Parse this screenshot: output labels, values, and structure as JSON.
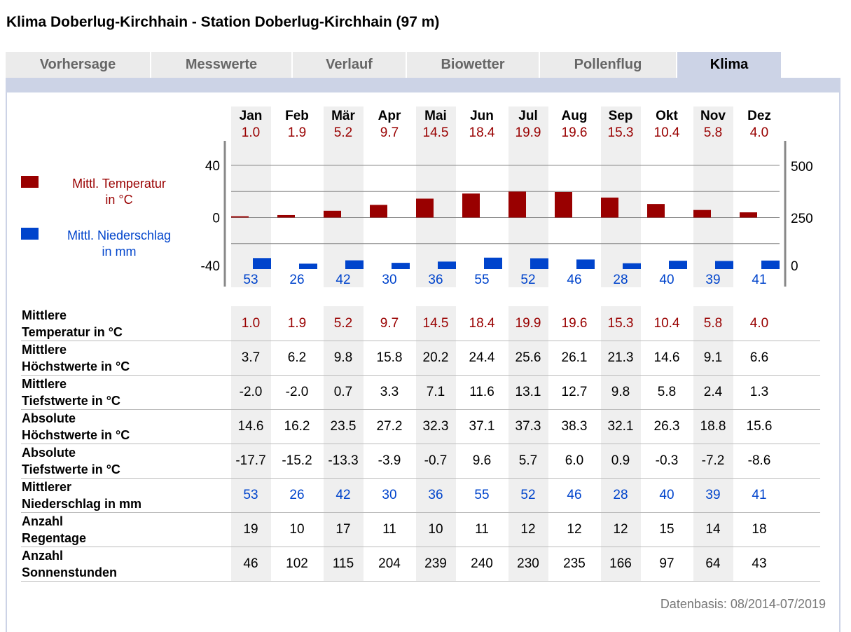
{
  "page_title": "Klima Doberlug-Kirchhain - Station Doberlug-Kirchhain (97 m)",
  "tabs": [
    {
      "label": "Vorhersage",
      "active": false
    },
    {
      "label": "Messwerte",
      "active": false
    },
    {
      "label": "Verlauf",
      "active": false
    },
    {
      "label": "Biowetter",
      "active": false
    },
    {
      "label": "Pollenflug",
      "active": false
    },
    {
      "label": "Klima",
      "active": true
    }
  ],
  "legend": {
    "temp_line1": "Mittl. Temperatur",
    "temp_line2": "in °C",
    "rain_line1": "Mittl. Niederschlag",
    "rain_line2": "in mm"
  },
  "colors": {
    "temperature": "#990000",
    "precipitation": "#0044cc",
    "accent": "#ccd3e6"
  },
  "chart_data": {
    "type": "bar",
    "categories": [
      "Jan",
      "Feb",
      "Mär",
      "Apr",
      "Mai",
      "Jun",
      "Jul",
      "Aug",
      "Sep",
      "Okt",
      "Nov",
      "Dez"
    ],
    "series": [
      {
        "name": "Mittl. Temperatur in °C",
        "axis": "left",
        "values": [
          1.0,
          1.9,
          5.2,
          9.7,
          14.5,
          18.4,
          19.9,
          19.6,
          15.3,
          10.4,
          5.8,
          4.0
        ]
      },
      {
        "name": "Mittl. Niederschlag in mm",
        "axis": "right",
        "values": [
          53,
          26,
          42,
          30,
          36,
          55,
          52,
          46,
          28,
          40,
          39,
          41
        ]
      }
    ],
    "temp_labels": [
      "1.0",
      "1.9",
      "5.2",
      "9.7",
      "14.5",
      "18.4",
      "19.9",
      "19.6",
      "15.3",
      "10.4",
      "5.8",
      "4.0"
    ],
    "rain_labels": [
      "53",
      "26",
      "42",
      "30",
      "36",
      "55",
      "52",
      "46",
      "28",
      "40",
      "39",
      "41"
    ],
    "left_ticks": [
      "40",
      "0",
      "-40"
    ],
    "right_ticks": [
      "500",
      "250",
      "0"
    ],
    "ylim_left": [
      -40,
      40
    ],
    "ylim_right": [
      0,
      500
    ],
    "grid": true
  },
  "table": {
    "rows": [
      {
        "label1": "Mittlere",
        "label2": "Temperatur in °C",
        "color": "#990000",
        "values": [
          "1.0",
          "1.9",
          "5.2",
          "9.7",
          "14.5",
          "18.4",
          "19.9",
          "19.6",
          "15.3",
          "10.4",
          "5.8",
          "4.0"
        ]
      },
      {
        "label1": "Mittlere",
        "label2": "Höchstwerte in °C",
        "color": "#000000",
        "values": [
          "3.7",
          "6.2",
          "9.8",
          "15.8",
          "20.2",
          "24.4",
          "25.6",
          "26.1",
          "21.3",
          "14.6",
          "9.1",
          "6.6"
        ]
      },
      {
        "label1": "Mittlere",
        "label2": "Tiefstwerte in °C",
        "color": "#000000",
        "values": [
          "-2.0",
          "-2.0",
          "0.7",
          "3.3",
          "7.1",
          "11.6",
          "13.1",
          "12.7",
          "9.8",
          "5.8",
          "2.4",
          "1.3"
        ]
      },
      {
        "label1": "Absolute",
        "label2": "Höchstwerte in °C",
        "color": "#000000",
        "values": [
          "14.6",
          "16.2",
          "23.5",
          "27.2",
          "32.3",
          "37.1",
          "37.3",
          "38.3",
          "32.1",
          "26.3",
          "18.8",
          "15.6"
        ]
      },
      {
        "label1": "Absolute",
        "label2": "Tiefstwerte in °C",
        "color": "#000000",
        "values": [
          "-17.7",
          "-15.2",
          "-13.3",
          "-3.9",
          "-0.7",
          "9.6",
          "5.7",
          "6.0",
          "0.9",
          "-0.3",
          "-7.2",
          "-8.6"
        ]
      },
      {
        "label1": "Mittlerer",
        "label2": "Niederschlag in mm",
        "color": "#0044cc",
        "values": [
          "53",
          "26",
          "42",
          "30",
          "36",
          "55",
          "52",
          "46",
          "28",
          "40",
          "39",
          "41"
        ]
      },
      {
        "label1": "Anzahl",
        "label2": "Regentage",
        "color": "#000000",
        "values": [
          "19",
          "10",
          "17",
          "11",
          "10",
          "11",
          "12",
          "12",
          "12",
          "15",
          "14",
          "18"
        ]
      },
      {
        "label1": "Anzahl",
        "label2": "Sonnenstunden",
        "color": "#000000",
        "values": [
          "46",
          "102",
          "115",
          "204",
          "239",
          "240",
          "230",
          "235",
          "166",
          "97",
          "64",
          "43"
        ]
      }
    ]
  },
  "footer": "Datenbasis: 08/2014-07/2019"
}
